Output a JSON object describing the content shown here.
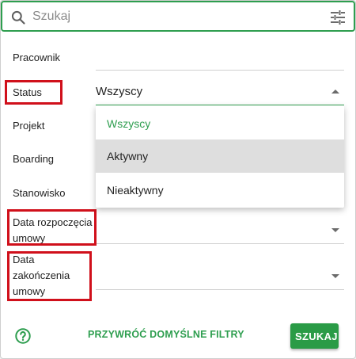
{
  "search": {
    "placeholder": "Szukaj"
  },
  "filters": {
    "employee_label": "Pracownik",
    "status_label": "Status",
    "status_value": "Wszyscy",
    "project_label": "Projekt",
    "boarding_label": "Boarding",
    "position_label": "Stanowisko",
    "contract_start_label_line1": "Data rozpoczęcia",
    "contract_start_label_line2": "umowy",
    "contract_end_label_line1": "Data",
    "contract_end_label_line2": "zakończenia",
    "contract_end_label_line3": "umowy"
  },
  "status_dropdown": {
    "options": [
      "Wszyscy",
      "Aktywny",
      "Nieaktywny"
    ],
    "selected": "Wszyscy",
    "hovered": "Aktywny"
  },
  "footer": {
    "reset_label": "PRZYWRÓĆ DOMYŚLNE FILTRY",
    "search_label": "SZUKAJ"
  },
  "icons": {
    "search": "search-icon",
    "filter": "tune-icon",
    "help": "help-circle-icon",
    "dropdown_open": "caret-up-icon",
    "dropdown_closed": "caret-down-icon"
  },
  "colors": {
    "accent": "#2e9e4f",
    "highlight": "#d0101b",
    "hover": "#dedede"
  }
}
